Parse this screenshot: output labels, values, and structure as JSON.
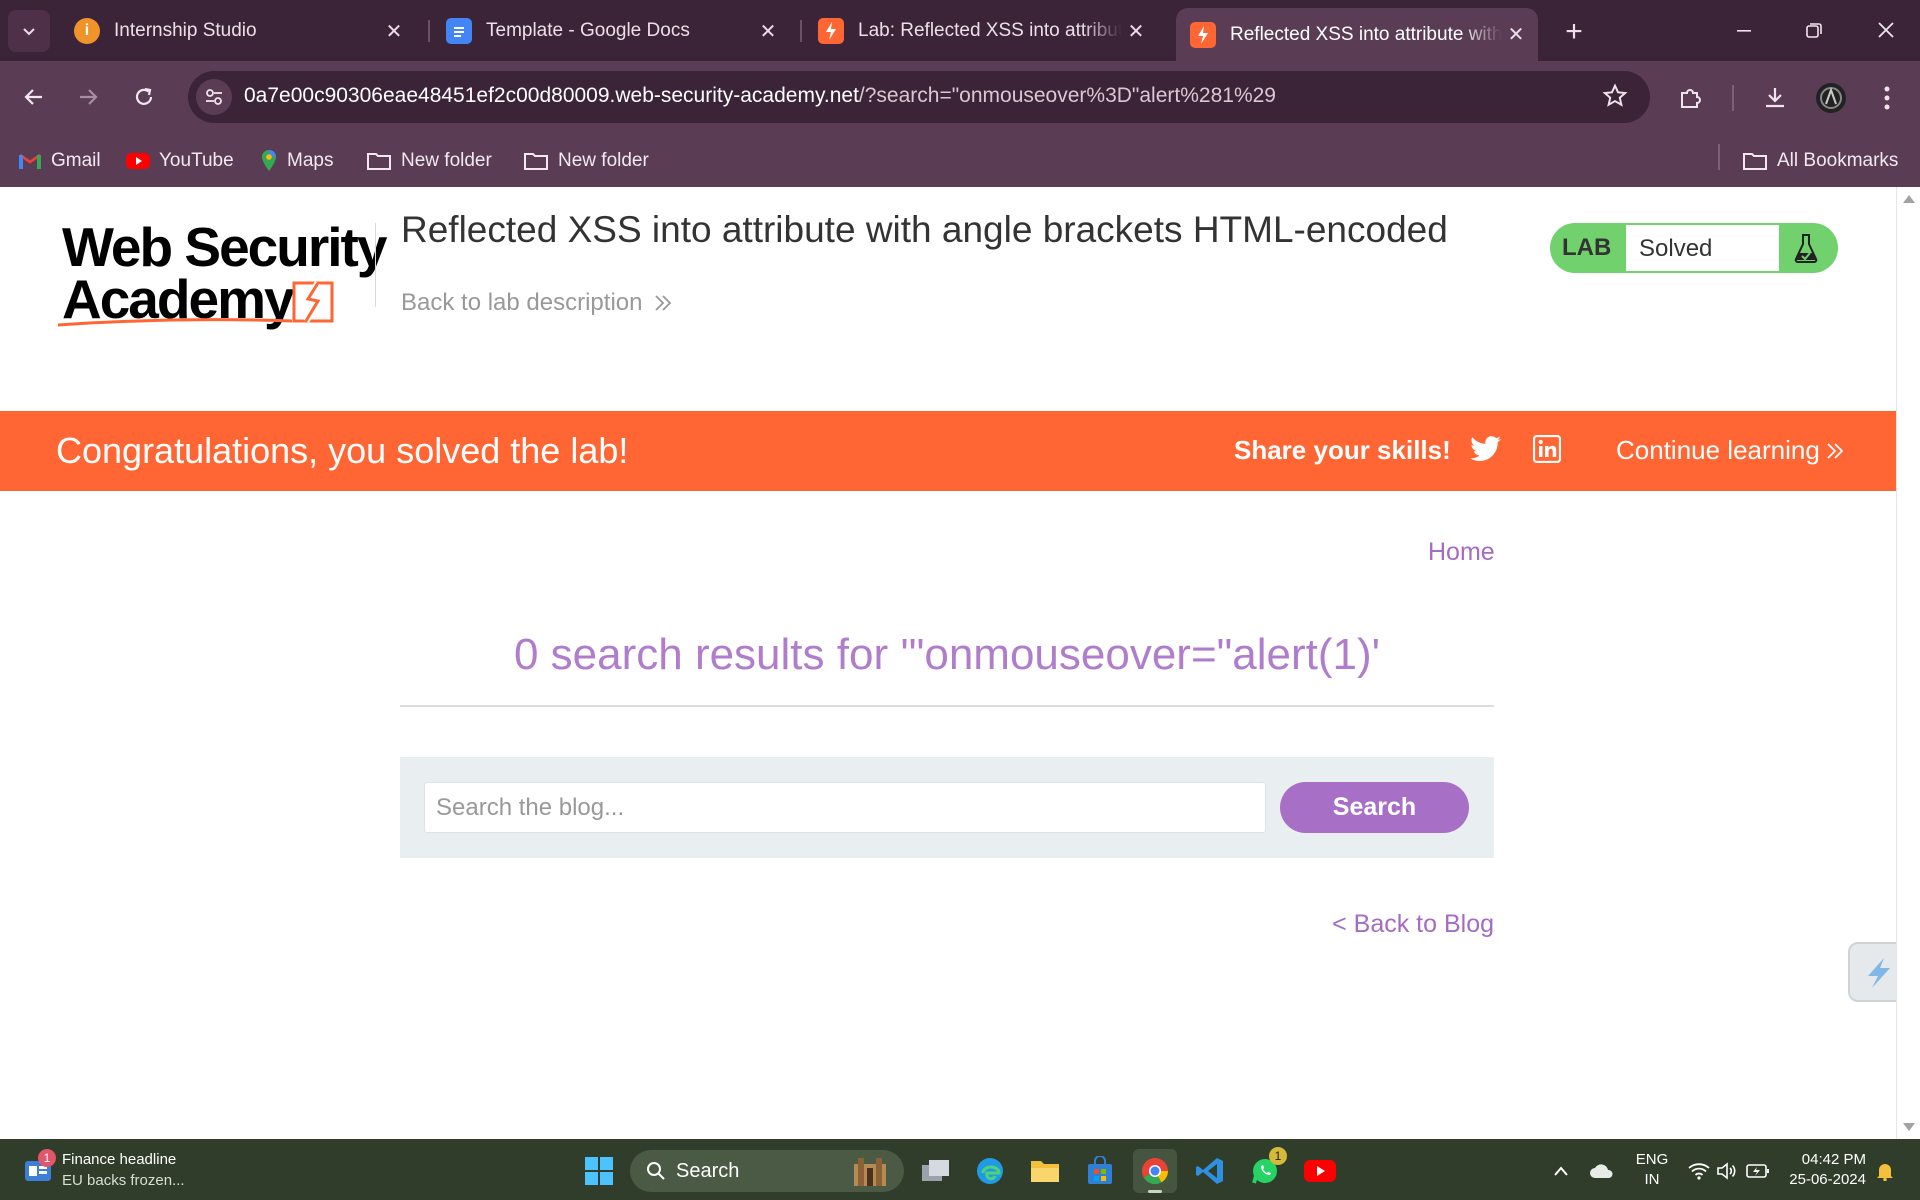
{
  "browser": {
    "tabs": [
      {
        "title": "Internship Studio",
        "icon": "internship-studio-icon"
      },
      {
        "title": "Template - Google Docs",
        "icon": "google-docs-icon"
      },
      {
        "title": "Lab: Reflected XSS into attribute with angle brackets HTML-encoded",
        "icon": "portswigger-icon"
      },
      {
        "title": "Reflected XSS into attribute with angle brackets HTML-encoded",
        "icon": "portswigger-icon",
        "active": true
      }
    ],
    "url_host": "0a7e00c90306eae48451ef2c00d80009.web-security-academy.net",
    "url_path": "/?search=\"onmouseover%3D\"alert%281%29",
    "bookmarks": [
      {
        "label": "Gmail",
        "icon": "gmail-icon"
      },
      {
        "label": "YouTube",
        "icon": "youtube-icon"
      },
      {
        "label": "Maps",
        "icon": "maps-icon"
      },
      {
        "label": "New folder",
        "icon": "folder-icon"
      },
      {
        "label": "New folder",
        "icon": "folder-icon"
      }
    ],
    "all_bookmarks": "All Bookmarks"
  },
  "page": {
    "logo": {
      "line1": "Web Security",
      "line2": "Academy"
    },
    "lab_title": "Reflected XSS into attribute with angle brackets HTML-encoded",
    "back_to_description": "Back to lab description",
    "lab_badge": {
      "tag": "LAB",
      "status": "Solved"
    },
    "banner": {
      "message": "Congratulations, you solved the lab!",
      "share": "Share your skills!",
      "continue": "Continue learning"
    },
    "home_link": "Home",
    "results_heading": "0 search results for '\"onmouseover=\"alert(1)'",
    "search": {
      "placeholder": "Search the blog...",
      "value": "",
      "button": "Search"
    },
    "back_to_blog": "< Back to Blog"
  },
  "taskbar": {
    "news": {
      "badge": "1",
      "title": "Finance headline",
      "subtitle": "EU backs frozen..."
    },
    "search_label": "Search",
    "whatsapp_badge": "1",
    "lang_line1": "ENG",
    "lang_line2": "IN",
    "time": "04:42 PM",
    "date": "25-06-2024"
  },
  "colors": {
    "chrome_dark": "#3b2438",
    "chrome": "#5b3c55",
    "banner": "#ff6633",
    "accent_purple": "#a86fc6",
    "lab_green": "#70d16d",
    "taskbar": "#2f3d2a"
  }
}
